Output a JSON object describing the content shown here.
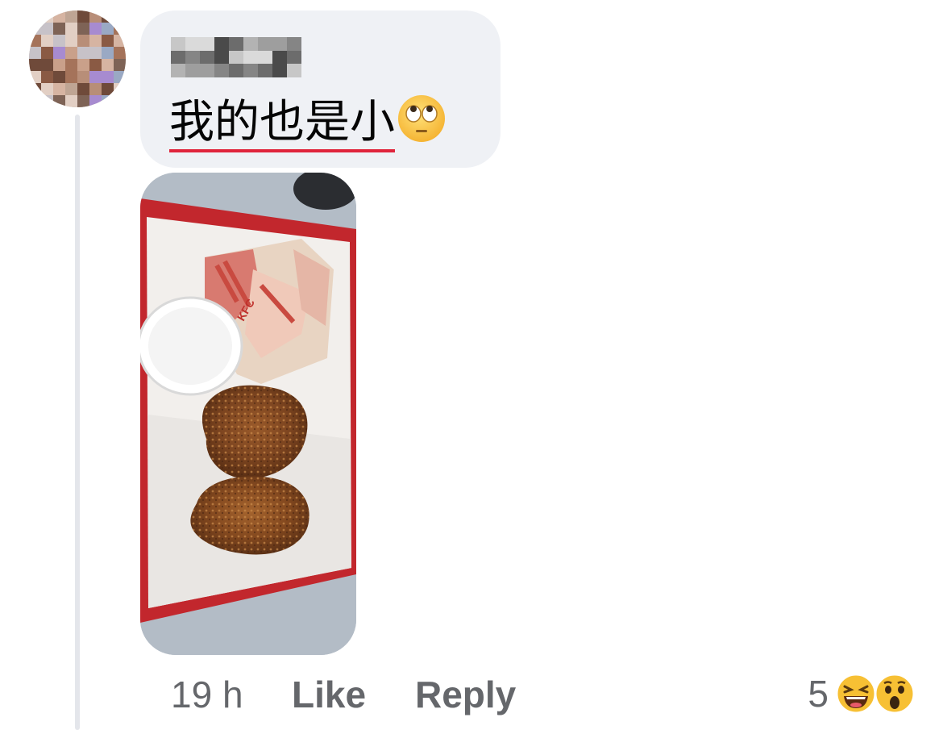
{
  "comment": {
    "author_name_blurred": true,
    "text": "我的也是小",
    "emoji": "face-with-rolling-eyes-icon",
    "underline_color": "#e0243b"
  },
  "meta": {
    "time": "19 h",
    "like_label": "Like",
    "reply_label": "Reply"
  },
  "reactions": {
    "count": "5",
    "icons": [
      "laughing-face-icon",
      "wow-face-icon"
    ]
  },
  "colors": {
    "bubble": "#eff1f5",
    "secondary_text": "#65676b",
    "thread_line": "#e4e6eb"
  }
}
